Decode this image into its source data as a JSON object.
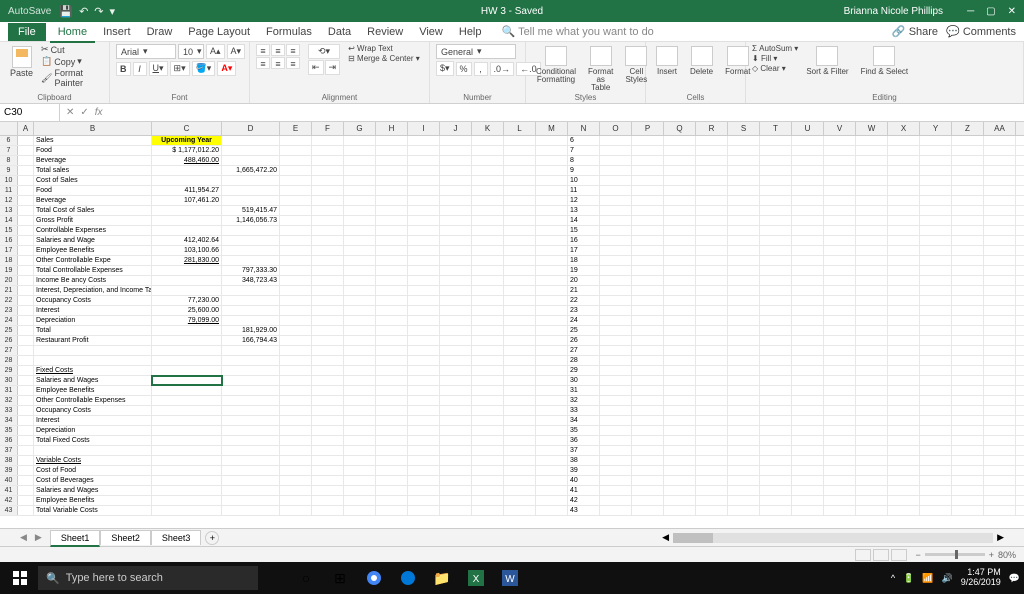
{
  "titlebar": {
    "autosave": "AutoSave",
    "doc": "HW 3 - Saved",
    "user": "Brianna Nicole Phillips"
  },
  "ribbon": {
    "file": "File",
    "tabs": [
      "Home",
      "Insert",
      "Draw",
      "Page Layout",
      "Formulas",
      "Data",
      "Review",
      "View",
      "Help"
    ],
    "active": "Home",
    "tell": "Tell me what you want to do",
    "share": "Share",
    "comments": "Comments",
    "clipboard": {
      "paste": "Paste",
      "cut": "Cut",
      "copy": "Copy",
      "fp": "Format Painter",
      "label": "Clipboard"
    },
    "font": {
      "name": "Arial",
      "size": "10",
      "label": "Font"
    },
    "alignment": {
      "wrap": "Wrap Text",
      "merge": "Merge & Center",
      "label": "Alignment"
    },
    "number": {
      "format": "General",
      "label": "Number"
    },
    "styles": {
      "cf": "Conditional\nFormatting",
      "ft": "Format as\nTable",
      "cs": "Cell\nStyles",
      "label": "Styles"
    },
    "cells": {
      "ins": "Insert",
      "del": "Delete",
      "fmt": "Format",
      "label": "Cells"
    },
    "editing": {
      "as": "AutoSum",
      "fill": "Fill",
      "clear": "Clear",
      "sort": "Sort &\nFilter",
      "find": "Find &\nSelect",
      "label": "Editing"
    }
  },
  "fx": {
    "cell": "C30",
    "value": ""
  },
  "cols": [
    "A",
    "B",
    "C",
    "D",
    "E",
    "F",
    "G",
    "H",
    "I",
    "J",
    "K",
    "L",
    "M",
    "N",
    "O",
    "P",
    "Q",
    "R",
    "S",
    "T",
    "U",
    "V",
    "W",
    "X",
    "Y",
    "Z",
    "AA"
  ],
  "colW": {
    "A": 16,
    "B": 118,
    "C": 70,
    "D": 58,
    "rest": 32
  },
  "rows": [
    {
      "n": 6,
      "b": "Sales",
      "c": "Upcoming Year",
      "c_cls": "upcoming c"
    },
    {
      "n": 7,
      "b": "        Food",
      "c": "$ 1,177,012.20",
      "c_cls": "r"
    },
    {
      "n": 8,
      "b": "        Beverage",
      "c": "488,460.00",
      "c_cls": "r ul"
    },
    {
      "n": 9,
      "b": "        Total sales",
      "d": "1,665,472.20",
      "d_cls": "r"
    },
    {
      "n": 10,
      "b": "Cost of Sales"
    },
    {
      "n": 11,
      "b": "        Food",
      "c": "411,954.27",
      "c_cls": "r"
    },
    {
      "n": 12,
      "b": "        Beverage",
      "c": "107,461.20",
      "c_cls": "r"
    },
    {
      "n": 13,
      "b": "        Total Cost of Sales",
      "d": "519,415.47",
      "d_cls": "r"
    },
    {
      "n": 14,
      "b": "Gross Profit",
      "d": "1,146,056.73",
      "d_cls": "r"
    },
    {
      "n": 15,
      "b": "Controllable Expenses"
    },
    {
      "n": 16,
      "b": "        Salaries and Wage",
      "c": "412,402.64",
      "c_cls": "r"
    },
    {
      "n": 17,
      "b": "        Employee Benefits",
      "c": "103,100.66",
      "c_cls": "r"
    },
    {
      "n": 18,
      "b": "        Other Controllable Expe",
      "c": "281,830.00",
      "c_cls": "r ul"
    },
    {
      "n": 19,
      "b": "Total Controllable Expenses",
      "d": "797,333.30",
      "d_cls": "r"
    },
    {
      "n": 20,
      "b": "Income Be ancy Costs",
      "d": "348,723.43",
      "d_cls": "r"
    },
    {
      "n": 21,
      "b": "Interest, Depreciation, and Income Taxes"
    },
    {
      "n": 22,
      "b": "Occupancy Costs",
      "c": "77,230.00",
      "c_cls": "r"
    },
    {
      "n": 23,
      "b": "Interest",
      "c": "25,600.00",
      "c_cls": "r"
    },
    {
      "n": 24,
      "b": "Depreciation",
      "c": "79,099.00",
      "c_cls": "r ul"
    },
    {
      "n": 25,
      "b": "Total",
      "d": "181,929.00",
      "d_cls": "r"
    },
    {
      "n": 26,
      "b": "Restaurant Profit",
      "d": "166,794.43",
      "d_cls": "r"
    },
    {
      "n": 27
    },
    {
      "n": 28
    },
    {
      "n": 29,
      "b": "Fixed Costs",
      "b_cls": "ul"
    },
    {
      "n": 30,
      "b": "Salaries and Wages",
      "c_cls": "curr"
    },
    {
      "n": 31,
      "b": "Employee Benefits"
    },
    {
      "n": 32,
      "b": "Other Controllable Expenses"
    },
    {
      "n": 33,
      "b": "Occupancy Costs"
    },
    {
      "n": 34,
      "b": "Interest"
    },
    {
      "n": 35,
      "b": "Depreciation"
    },
    {
      "n": 36,
      "b": "Total Fixed Costs"
    },
    {
      "n": 37
    },
    {
      "n": 38,
      "b": "Variable Costs",
      "b_cls": "ul"
    },
    {
      "n": 39,
      "b": "Cost of Food"
    },
    {
      "n": 40,
      "b": "Cost of Beverages"
    },
    {
      "n": 41,
      "b": "Salaries and Wages"
    },
    {
      "n": 42,
      "b": "Employee Benefits"
    },
    {
      "n": 43,
      "b": "Total Variable Costs"
    }
  ],
  "sheets": {
    "tabs": [
      "Sheet1",
      "Sheet2",
      "Sheet3"
    ],
    "active": "Sheet1"
  },
  "status": {
    "zoom": "80%"
  },
  "taskbar": {
    "search": "Type here to search",
    "time": "1:47 PM",
    "date": "9/26/2019"
  }
}
